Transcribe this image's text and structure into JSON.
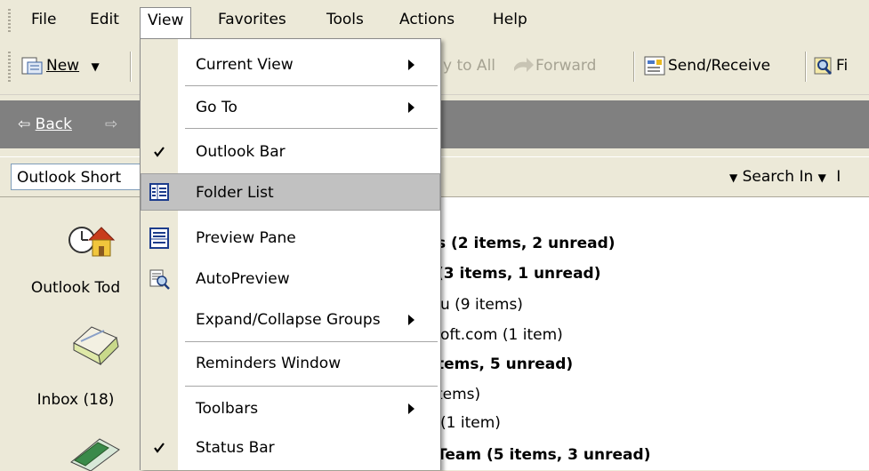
{
  "menubar": {
    "items": [
      "File",
      "Edit",
      "View",
      "Favorites",
      "Tools",
      "Actions",
      "Help"
    ]
  },
  "toolbar": {
    "new_label": "New",
    "reply_all_label": "y to All",
    "forward_label": "Forward",
    "send_receive_label": "Send/Receive",
    "find_label": "Fi"
  },
  "backbar": {
    "back_label": "Back"
  },
  "header": {
    "shortcuts_title": "Outlook Short",
    "search_in_label": "Search In",
    "search_in_extra": "I"
  },
  "outlook_bar": {
    "items": [
      {
        "label": "Outlook Tod",
        "icon": "outlook-today-icon"
      },
      {
        "label": "Inbox (18)",
        "icon": "inbox-icon"
      },
      {
        "label": "",
        "icon": "calendar-icon"
      }
    ]
  },
  "message_list": {
    "rows": [
      {
        "text": "s (2 items, 2 unread)",
        "bold": true
      },
      {
        "text": " (3 items, 1 unread)",
        "bold": true
      },
      {
        "text": "u (9 items)",
        "bold": false
      },
      {
        "text": "oft.com (1 item)",
        "bold": false
      },
      {
        "text": "tems, 5 unread)",
        "bold": true
      },
      {
        "text": "tems)",
        "bold": false
      },
      {
        "text": "(1 item)",
        "bold": false
      },
      {
        "text": "Team (5 items, 3 unread)",
        "bold": true
      }
    ]
  },
  "view_menu": {
    "items": [
      {
        "label": "Current View",
        "submenu": true
      },
      {
        "label": "Go To",
        "submenu": true
      },
      {
        "label": "Outlook Bar",
        "checked": true
      },
      {
        "label": "Folder List",
        "icon": "folder-list-icon",
        "highlighted": true
      },
      {
        "label": "Preview Pane",
        "icon": "preview-pane-icon"
      },
      {
        "label": "AutoPreview",
        "icon": "autopreview-icon"
      },
      {
        "label": "Expand/Collapse Groups",
        "submenu": true
      },
      {
        "label": "Reminders Window"
      },
      {
        "label": "Toolbars",
        "submenu": true
      },
      {
        "label": "Status Bar",
        "checked": true
      }
    ]
  },
  "colors": {
    "chrome": "#ece9d8",
    "backbar": "#808080",
    "highlight": "#c1c1c1"
  }
}
